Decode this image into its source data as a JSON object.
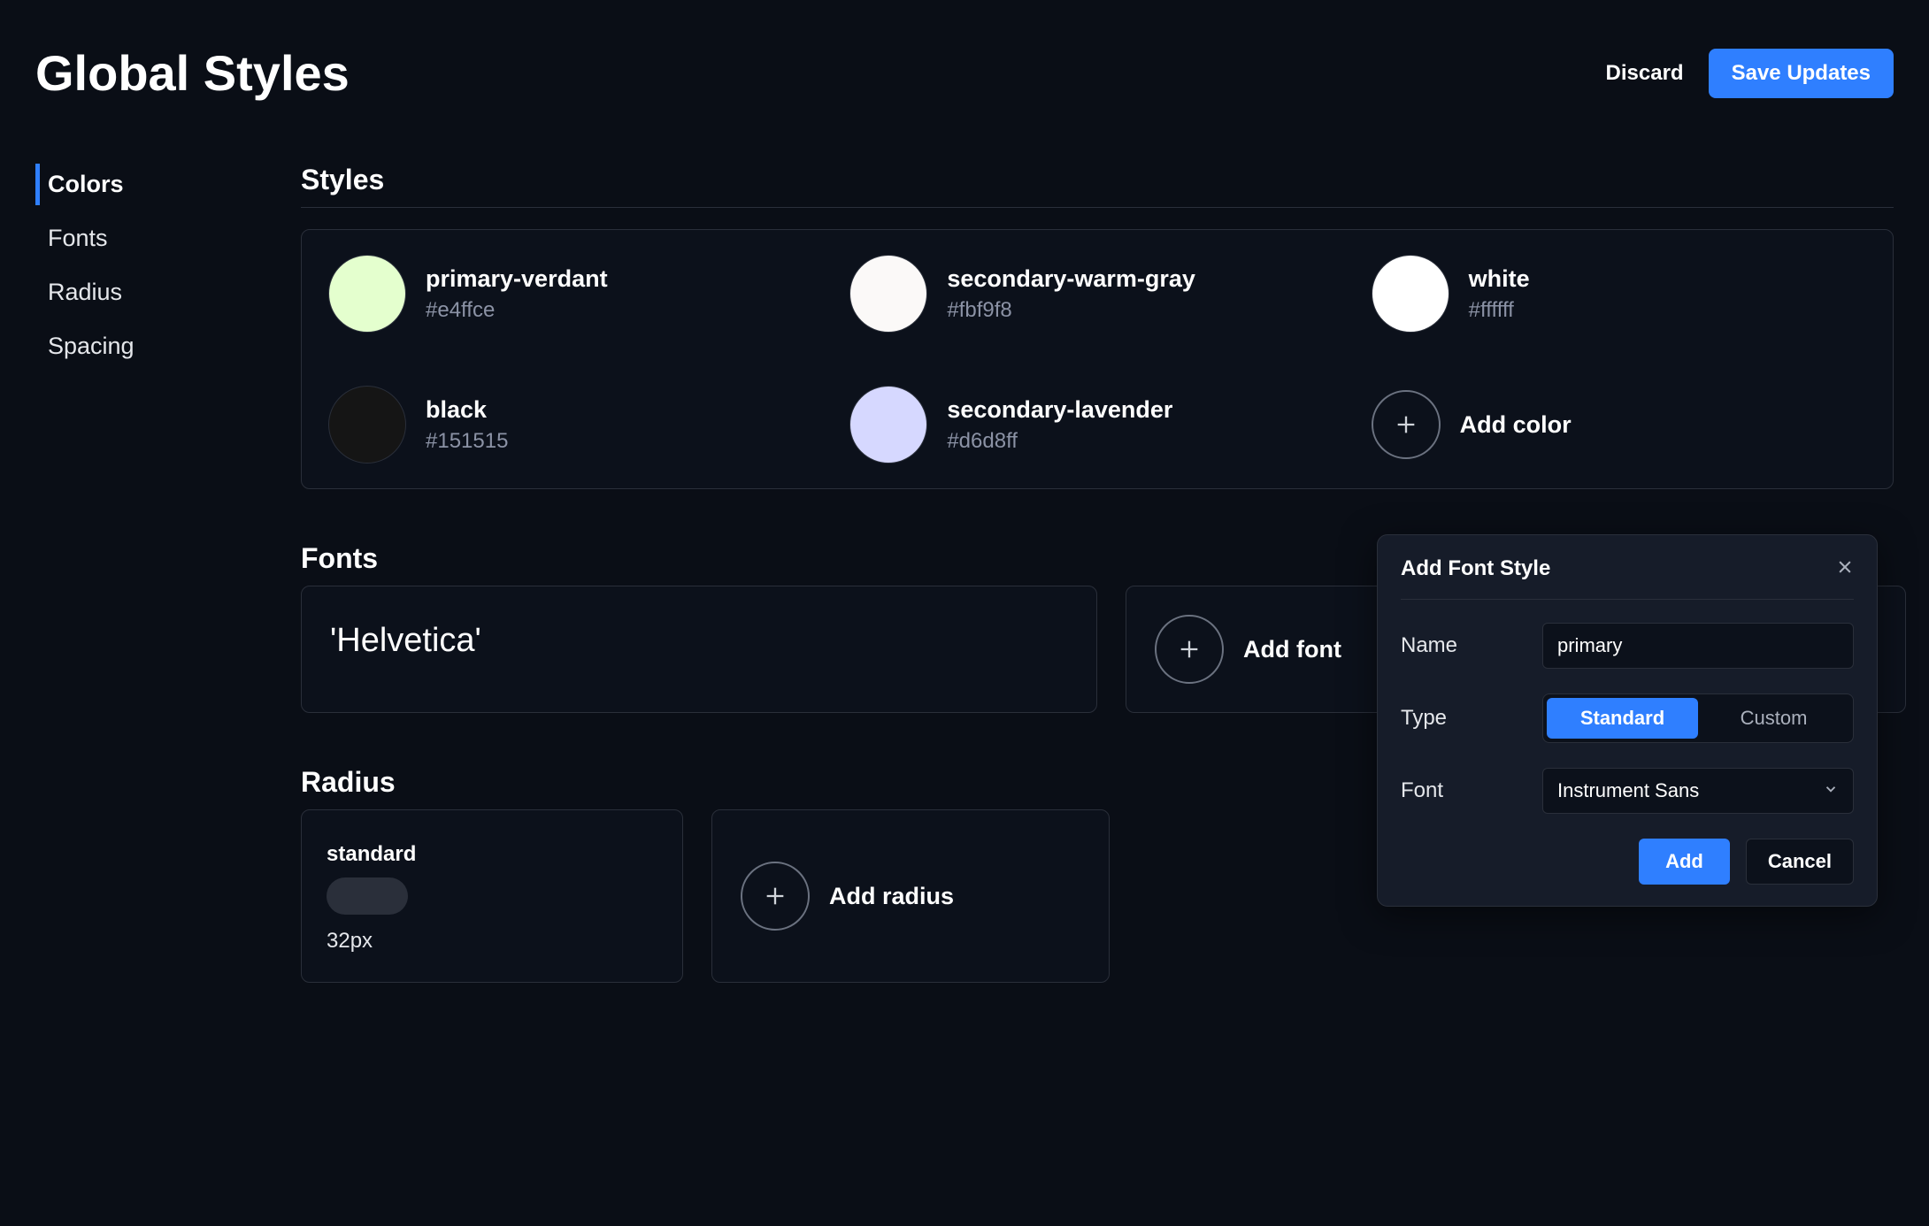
{
  "header": {
    "title": "Global Styles",
    "discard": "Discard",
    "save": "Save Updates"
  },
  "sidebar": {
    "items": [
      {
        "label": "Colors",
        "active": true
      },
      {
        "label": "Fonts",
        "active": false
      },
      {
        "label": "Radius",
        "active": false
      },
      {
        "label": "Spacing",
        "active": false
      }
    ]
  },
  "sections": {
    "styles_title": "Styles",
    "fonts_title": "Fonts",
    "radius_title": "Radius"
  },
  "colors": [
    {
      "name": "primary-verdant",
      "hex": "#e4ffce"
    },
    {
      "name": "secondary-warm-gray",
      "hex": "#fbf9f8"
    },
    {
      "name": "white",
      "hex": "#ffffff"
    },
    {
      "name": "black",
      "hex": "#151515"
    },
    {
      "name": "secondary-lavender",
      "hex": "#d6d8ff"
    }
  ],
  "add_color_label": "Add color",
  "fonts": [
    {
      "display": "'Helvetica'"
    }
  ],
  "add_font_label": "Add font",
  "radius": [
    {
      "name": "standard",
      "value": "32px"
    }
  ],
  "add_radius_label": "Add radius",
  "popover": {
    "title": "Add Font Style",
    "name_label": "Name",
    "name_value": "primary",
    "type_label": "Type",
    "type_options": {
      "standard": "Standard",
      "custom": "Custom"
    },
    "type_selected": "Standard",
    "font_label": "Font",
    "font_value": "Instrument Sans",
    "add": "Add",
    "cancel": "Cancel"
  }
}
